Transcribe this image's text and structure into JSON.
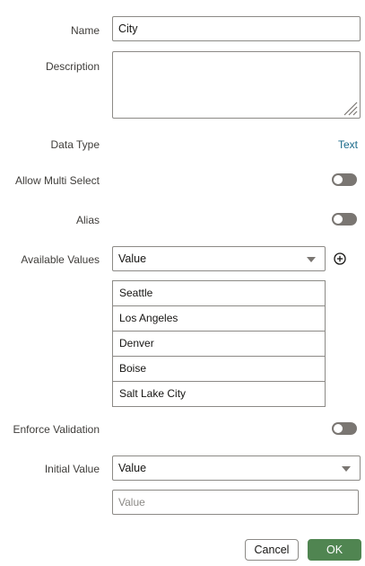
{
  "form": {
    "name": {
      "label": "Name",
      "value": "City"
    },
    "description": {
      "label": "Description",
      "value": ""
    },
    "data_type": {
      "label": "Data Type",
      "value": "Text"
    },
    "allow_multi_select": {
      "label": "Allow Multi Select",
      "on": false
    },
    "alias": {
      "label": "Alias",
      "on": false
    },
    "available_values": {
      "label": "Available Values",
      "selected": "Value",
      "items": [
        "Seattle",
        "Los Angeles",
        "Denver",
        "Boise",
        "Salt Lake City"
      ]
    },
    "enforce_validation": {
      "label": "Enforce Validation",
      "on": false
    },
    "initial_value": {
      "label": "Initial Value",
      "selected": "Value",
      "placeholder": "Value"
    }
  },
  "buttons": {
    "cancel": "Cancel",
    "ok": "OK"
  },
  "colors": {
    "accent_link": "#1b6a8a",
    "ok_button": "#508551",
    "toggle_off": "#7a7672",
    "border": "#8c8a86"
  },
  "icons": {
    "add": "plus-circle-icon",
    "caret": "chevron-down-icon",
    "resize": "resize-grip-icon"
  }
}
